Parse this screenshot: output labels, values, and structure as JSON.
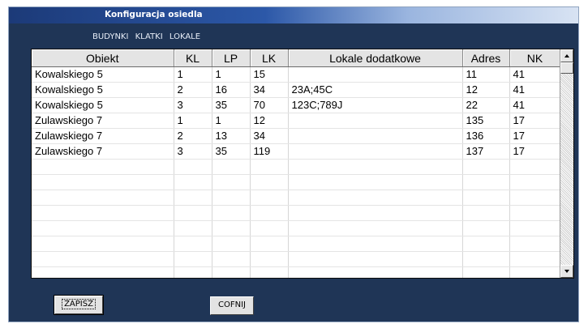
{
  "window": {
    "title": "Konfiguracja osiedla"
  },
  "tabs": [
    "BUDYNKI",
    "KLATKI",
    "LOKALE"
  ],
  "table": {
    "columns": [
      "Obiekt",
      "KL",
      "LP",
      "LK",
      "Lokale dodatkowe",
      "Adres",
      "NK"
    ],
    "rows": [
      [
        "Kowalskiego 5",
        "1",
        "1",
        "15",
        "",
        "11",
        "41"
      ],
      [
        "Kowalskiego 5",
        "2",
        "16",
        "34",
        "23A;45C",
        "12",
        "41"
      ],
      [
        "Kowalskiego 5",
        "3",
        "35",
        "70",
        "123C;789J",
        "22",
        "41"
      ],
      [
        "Zulawskiego 7",
        "1",
        "1",
        "12",
        "",
        "135",
        "17"
      ],
      [
        "Zulawskiego 7",
        "2",
        "13",
        "34",
        "",
        "136",
        "17"
      ],
      [
        "Zulawskiego 7",
        "3",
        "35",
        "119",
        "",
        "137",
        "17"
      ]
    ]
  },
  "buttons": {
    "save_label": "ZAPISZ",
    "cancel_label": "COFNIJ"
  },
  "colors": {
    "window_bg": "#1f3556",
    "titlebar_start": "#1c3a78",
    "titlebar_end": "#d8e3f3",
    "grid_bg": "#ffffff",
    "header_bg": "#e4e4e4"
  }
}
